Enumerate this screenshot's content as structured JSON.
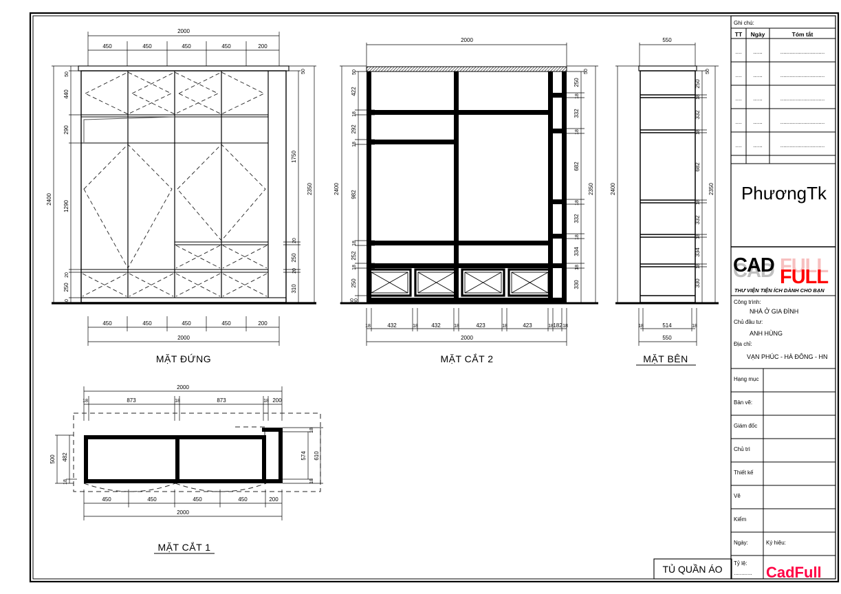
{
  "sheet": {
    "drawing_title": "TỦ QUẦN ÁO"
  },
  "views": [
    {
      "id": "elevation",
      "title": "MẶT ĐỨNG",
      "top_dims_overall": "2000",
      "top_dims": [
        "450",
        "450",
        "450",
        "450",
        "200"
      ],
      "bottom_dims": [
        "450",
        "450",
        "450",
        "450",
        "200"
      ],
      "bottom_overall": "2000",
      "left_overall": "2400",
      "left_dims": [
        "50",
        "440",
        "290",
        "1290",
        "20",
        "250",
        "50"
      ],
      "right_overall": "2350",
      "right_dims": [
        "50",
        "1750",
        "20",
        "250",
        "20",
        "310"
      ]
    },
    {
      "id": "section2",
      "title": "MẶT CẮT 2",
      "top_overall": "2000",
      "left_overall": "2400",
      "left_dims": [
        "50",
        "422",
        "18",
        "292",
        "18",
        "982",
        "18",
        "252",
        "18",
        "250",
        "50",
        "30"
      ],
      "right_overall": "2350",
      "right_dims": [
        "50",
        "250",
        "18",
        "332",
        "18",
        "682",
        "18",
        "332",
        "18",
        "334",
        "18",
        "330"
      ],
      "bottom_dims": [
        "18",
        "432",
        "18",
        "432",
        "18",
        "423",
        "18",
        "423",
        "18",
        "182",
        "18"
      ],
      "bottom_overall": "2000"
    },
    {
      "id": "sideview",
      "title": "MẶT BÊN",
      "top_overall": "550",
      "left_overall": "2400",
      "right_overall": "2350",
      "right_dims": [
        "50",
        "250",
        "18",
        "332",
        "18",
        "682",
        "18",
        "332",
        "18",
        "334",
        "18",
        "330"
      ],
      "bottom_dims": [
        "18",
        "514",
        "18"
      ],
      "bottom_overall": "550"
    },
    {
      "id": "section1",
      "title": "MẶT CẮT 1",
      "top_overall": "2000",
      "top_dims": [
        "18",
        "873",
        "18",
        "873",
        "18",
        "200"
      ],
      "bottom_dims": [
        "450",
        "450",
        "450",
        "450",
        "200"
      ],
      "bottom_overall": "2000",
      "left_overall": "500",
      "left_dims": [
        "482",
        "18"
      ],
      "right_dims": [
        "18",
        "574",
        "18"
      ],
      "right_overall": "610"
    }
  ],
  "titleblock": {
    "note_label": "Ghi chú:",
    "revision_headers": [
      "TT",
      "Ngày",
      "Tóm tắt"
    ],
    "revision_rows": [
      {
        "tt": "....",
        "ngay": "......",
        "tomtat": "............................."
      },
      {
        "tt": "....",
        "ngay": "......",
        "tomtat": "............................."
      },
      {
        "tt": "....",
        "ngay": "......",
        "tomtat": "............................."
      },
      {
        "tt": "....",
        "ngay": "......",
        "tomtat": "............................."
      },
      {
        "tt": "....",
        "ngay": "......",
        "tomtat": "............................."
      }
    ],
    "company_name": "PhươngTk",
    "logo": {
      "word1": "CAD",
      "word2": "FULL",
      "tagline": "THƯ VIỆN TIỆN ÍCH DÀNH CHO BẠN",
      "color_word1": "#000000",
      "color_word2": "#ff0000",
      "color_shadow": "#bfbfbf",
      "color_shadow2": "#f7bfbf"
    },
    "project": {
      "label_congtrinh": "Công trình:",
      "value_congtrinh": "NHÀ Ở GIA ĐÌNH",
      "label_chudautu": "Chủ đầu tư:",
      "value_chudautu": "ANH HÙNG",
      "label_diachi": "Địa chỉ:",
      "value_diachi": "VẠN PHÚC -  HÀ ĐÔNG - HN"
    },
    "rows": [
      {
        "label": "Hạng mục",
        "value": ""
      },
      {
        "label": "Bản vẽ:",
        "value": ""
      },
      {
        "label": "Giám đốc",
        "value": ""
      },
      {
        "label": "Chủ trì",
        "value": ""
      },
      {
        "label": "Thiết kế",
        "value": ""
      },
      {
        "label": "Vẽ",
        "value": ""
      },
      {
        "label": "Kiểm",
        "value": ""
      }
    ],
    "date_label": "Ngày:",
    "symbol_label": "Ký hiệu:",
    "scale_label": "Tỷ lệ:",
    "scale_value": "............",
    "watermark": "CadFull",
    "watermark_color": "#ff0044"
  }
}
